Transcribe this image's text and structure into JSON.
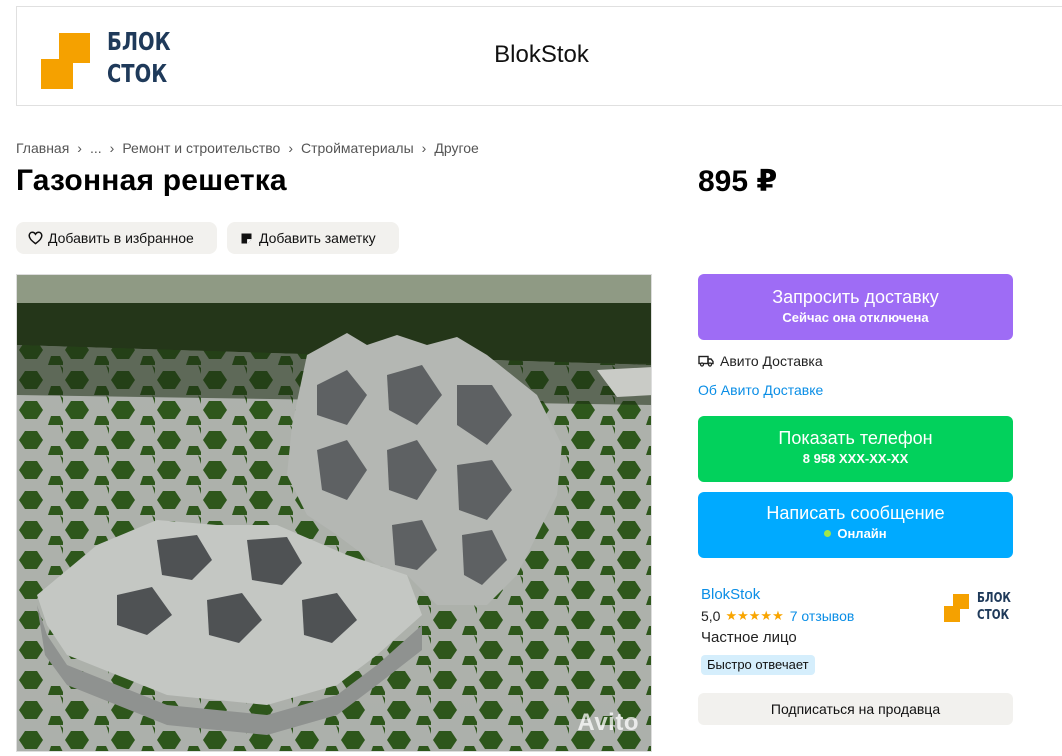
{
  "header": {
    "logo_line1": "БЛОК",
    "logo_line2": "СТОК",
    "title": "BlokStok"
  },
  "breadcrumb": [
    "Главная",
    "...",
    "Ремонт и строительство",
    "Стройматериалы",
    "Другое"
  ],
  "listing": {
    "title": "Газонная решетка",
    "price": "895 ₽",
    "favorite_label": "Добавить в избранное",
    "note_label": "Добавить заметку",
    "watermark": "Avito"
  },
  "actions": {
    "delivery_title": "Запросить доставку",
    "delivery_sub": "Сейчас она отключена",
    "avito_delivery": "Авито Доставка",
    "about_delivery": "Об Авито Доставке",
    "phone_title": "Показать телефон",
    "phone_sub": "8 958 XXX-XX-XX",
    "message_title": "Написать сообщение",
    "message_sub": "Онлайн"
  },
  "seller": {
    "name": "BlokStok",
    "rating": "5,0",
    "stars": "★★★★★",
    "reviews": "7 отзывов",
    "type": "Частное лицо",
    "badge": "Быстро отвечает",
    "subscribe": "Подписаться на продавца",
    "logo_line1": "БЛОК",
    "logo_line2": "СТОК"
  },
  "colors": {
    "delivery_button": "#9e6cf5",
    "phone_button": "#02d15c",
    "message_button": "#00aaff",
    "link": "#0a8ee6",
    "logo_orange": "#f5a100",
    "logo_navy": "#1f3a5a"
  },
  "icons": [
    "heart-icon",
    "note-icon",
    "truck-icon",
    "star-icon",
    "online-dot-icon"
  ]
}
